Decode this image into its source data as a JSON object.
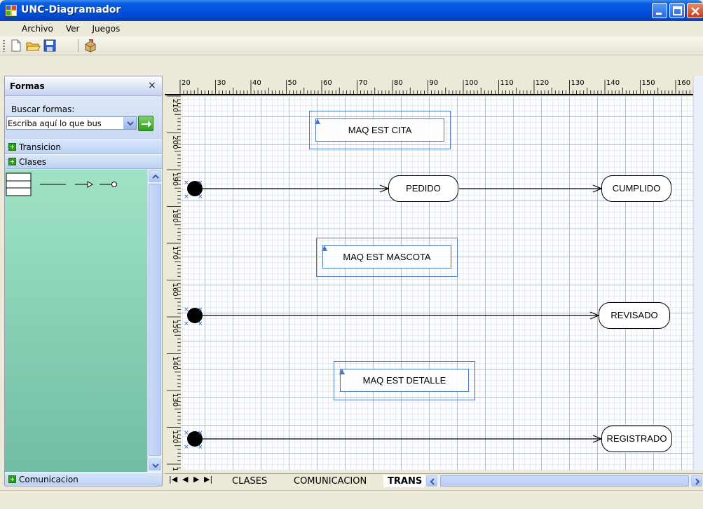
{
  "window": {
    "title": "UNC-Diagramador"
  },
  "menu": {
    "items": [
      "Archivo",
      "Ver",
      "Juegos"
    ]
  },
  "toolbar": {
    "buttons": [
      "new-file-icon",
      "open-folder-icon",
      "save-icon",
      "export-icon"
    ]
  },
  "panel": {
    "title": "Formas",
    "close": "×",
    "search_label": "Buscar formas:",
    "search_value": "Escriba aquí lo que bus",
    "categories": [
      "Transicion",
      "Clases",
      "Comunicacion"
    ]
  },
  "ruler": {
    "top_ticks": [
      "20",
      "30",
      "40",
      "50",
      "60",
      "70",
      "80",
      "90",
      "100",
      "110",
      "120",
      "130",
      "140",
      "150",
      "160"
    ],
    "left_ticks": [
      "210",
      "200",
      "190",
      "180",
      "170",
      "160",
      "150",
      "140",
      "130",
      "120",
      "110"
    ]
  },
  "diagram": {
    "frames": [
      "MAQ EST CITA",
      "MAQ EST MASCOTA",
      "MAQ EST DETALLE"
    ],
    "states": [
      "PEDIDO",
      "CUMPLIDO",
      "REVISADO",
      "REGISTRADO"
    ]
  },
  "tabs": {
    "items": [
      "CLASES",
      "COMUNICACION",
      "TRANS"
    ],
    "active": "TRANS"
  },
  "colors": {
    "titlebar": "#0054e3",
    "shapes_bg": "#8fd9ba",
    "frame_border": "#4a78c2"
  }
}
